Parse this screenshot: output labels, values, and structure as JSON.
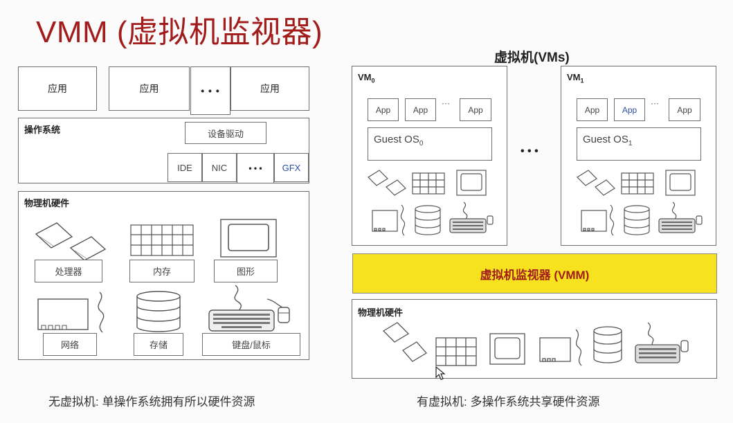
{
  "title": "VMM (虚拟机监视器)",
  "left": {
    "apps": [
      "应用",
      "应用",
      "应用"
    ],
    "app_ellipsis": "• • •",
    "os_label": "操作系统",
    "driver_label": "设备驱动",
    "drivers": [
      "IDE",
      "NIC",
      "GFX"
    ],
    "driver_ellipsis": "• • •",
    "hw_label": "物理机硬件",
    "hw_items": [
      "处理器",
      "内存",
      "图形",
      "网络",
      "存储",
      "键盘/鼠标"
    ],
    "caption": "无虚拟机: 单操作系统拥有所以硬件资源"
  },
  "right": {
    "vms_header": "虚拟机(VMs)",
    "vm0": {
      "label": "VM",
      "sub": "0",
      "apps": [
        "App",
        "App",
        "App"
      ],
      "app_ellipsis": "···",
      "os": "Guest OS",
      "os_sub": "0"
    },
    "vm1": {
      "label": "VM",
      "sub": "1",
      "apps": [
        "App",
        "App",
        "App"
      ],
      "app_ellipsis": "···",
      "os": "Guest OS",
      "os_sub": "1"
    },
    "vm_ellipsis": "• • •",
    "vmm_label": "虚拟机监视器 (VMM)",
    "hw_label": "物理机硬件",
    "caption": "有虚拟机: 多操作系统共享硬件资源"
  },
  "colors": {
    "title": "#a31c1c",
    "vmm_fill": "#f6e21e",
    "vmm_text": "#a31c1c",
    "border": "#6e6e6e"
  }
}
